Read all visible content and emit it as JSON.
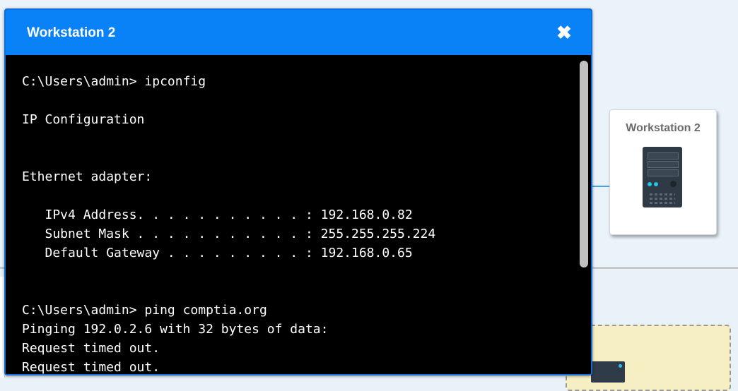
{
  "modal": {
    "title": "Workstation 2",
    "close_icon": "close-icon",
    "terminal_lines": [
      "C:\\Users\\admin> ipconfig",
      "IP Configuration",
      "Ethernet adapter:",
      "   IPv4 Address. . . . . . . . . . . : 192.168.0.82",
      "   Subnet Mask . . . . . . . . . . . : 255.255.255.224",
      "   Default Gateway . . . . . . . . . : 192.168.0.65",
      "C:\\Users\\admin> ping comptia.org",
      "Pinging 192.0.2.6 with 32 bytes of data:",
      "Request timed out.",
      "Request timed out."
    ]
  },
  "device_card": {
    "label": "Workstation 2",
    "icon": "workstation-tower-icon"
  },
  "colors": {
    "header": "#0a82f7",
    "terminal_bg": "#000000",
    "terminal_text": "#ffffff",
    "connection": "#4aa3df"
  }
}
